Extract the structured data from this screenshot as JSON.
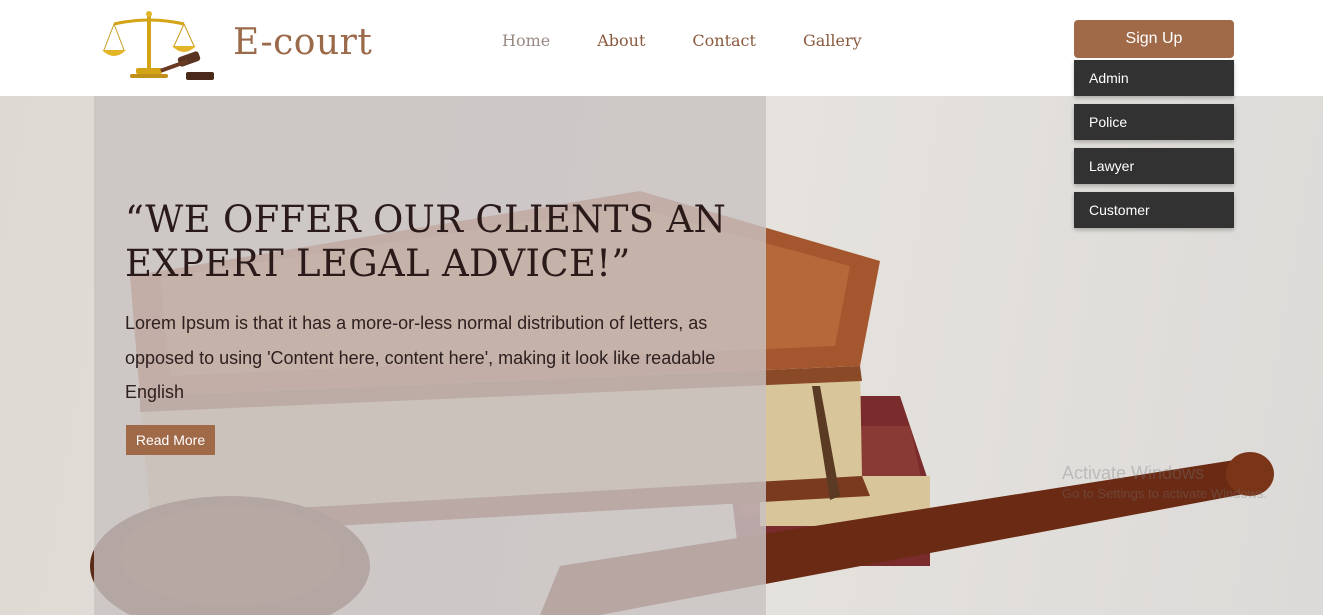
{
  "header": {
    "brand": "E-court",
    "logo_icon": "scales-of-justice-gavel-logo",
    "nav": [
      "Home",
      "About",
      "Contact",
      "Gallery"
    ],
    "signup_label": "Sign Up",
    "dropdown": [
      "Admin",
      "Police",
      "Lawyer",
      "Customer"
    ]
  },
  "hero": {
    "headline": "“WE OFFER OUR CLIENTS AN EXPERT LEGAL ADVICE!”",
    "paragraph": "Lorem Ipsum is that it has a more-or-less normal distribution of letters, as opposed to using 'Content here, content here', making it look like readable English",
    "read_more": "Read More",
    "background_image": "law-books-and-gavel"
  },
  "watermark": {
    "line1": "Activate Windows",
    "line2": "Go to Settings to activate Windows."
  },
  "colors": {
    "accent": "#a06a48",
    "dropdown_bg": "#323232",
    "brand_text": "#9a6a4a"
  }
}
